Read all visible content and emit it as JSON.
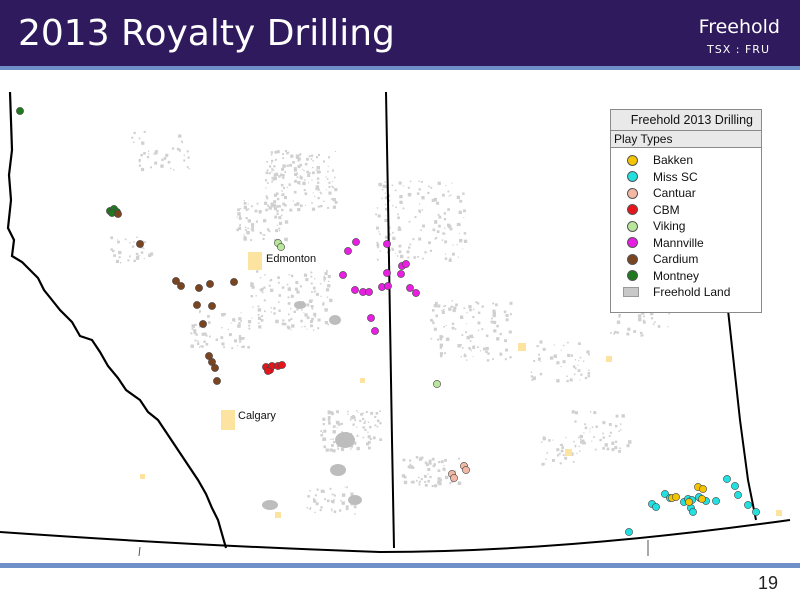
{
  "header": {
    "title": "2013 Royalty Drilling",
    "brand": "Freehold",
    "ticker": "TSX : FRU"
  },
  "footer": {
    "page_number": "19"
  },
  "legend": {
    "title": "Freehold 2013 Drilling",
    "subtitle": "Play Types",
    "items": [
      {
        "label": "Bakken",
        "color": "#f5c400"
      },
      {
        "label": "Miss SC",
        "color": "#22e0e0"
      },
      {
        "label": "Cantuar",
        "color": "#f3b8a3"
      },
      {
        "label": "CBM",
        "color": "#e8141c"
      },
      {
        "label": "Viking",
        "color": "#b9e69a"
      },
      {
        "label": "Mannville",
        "color": "#e61fe0"
      },
      {
        "label": "Cardium",
        "color": "#7a4420"
      },
      {
        "label": "Montney",
        "color": "#1f7a1f"
      },
      {
        "label": "Freehold Land",
        "color": "#c8c8c8"
      }
    ]
  },
  "map": {
    "cities": [
      "Edmonton",
      "Calgary"
    ],
    "colors": {
      "land": "#d0d0d0",
      "city_area": "#fde3a0",
      "border": "#000000"
    }
  }
}
